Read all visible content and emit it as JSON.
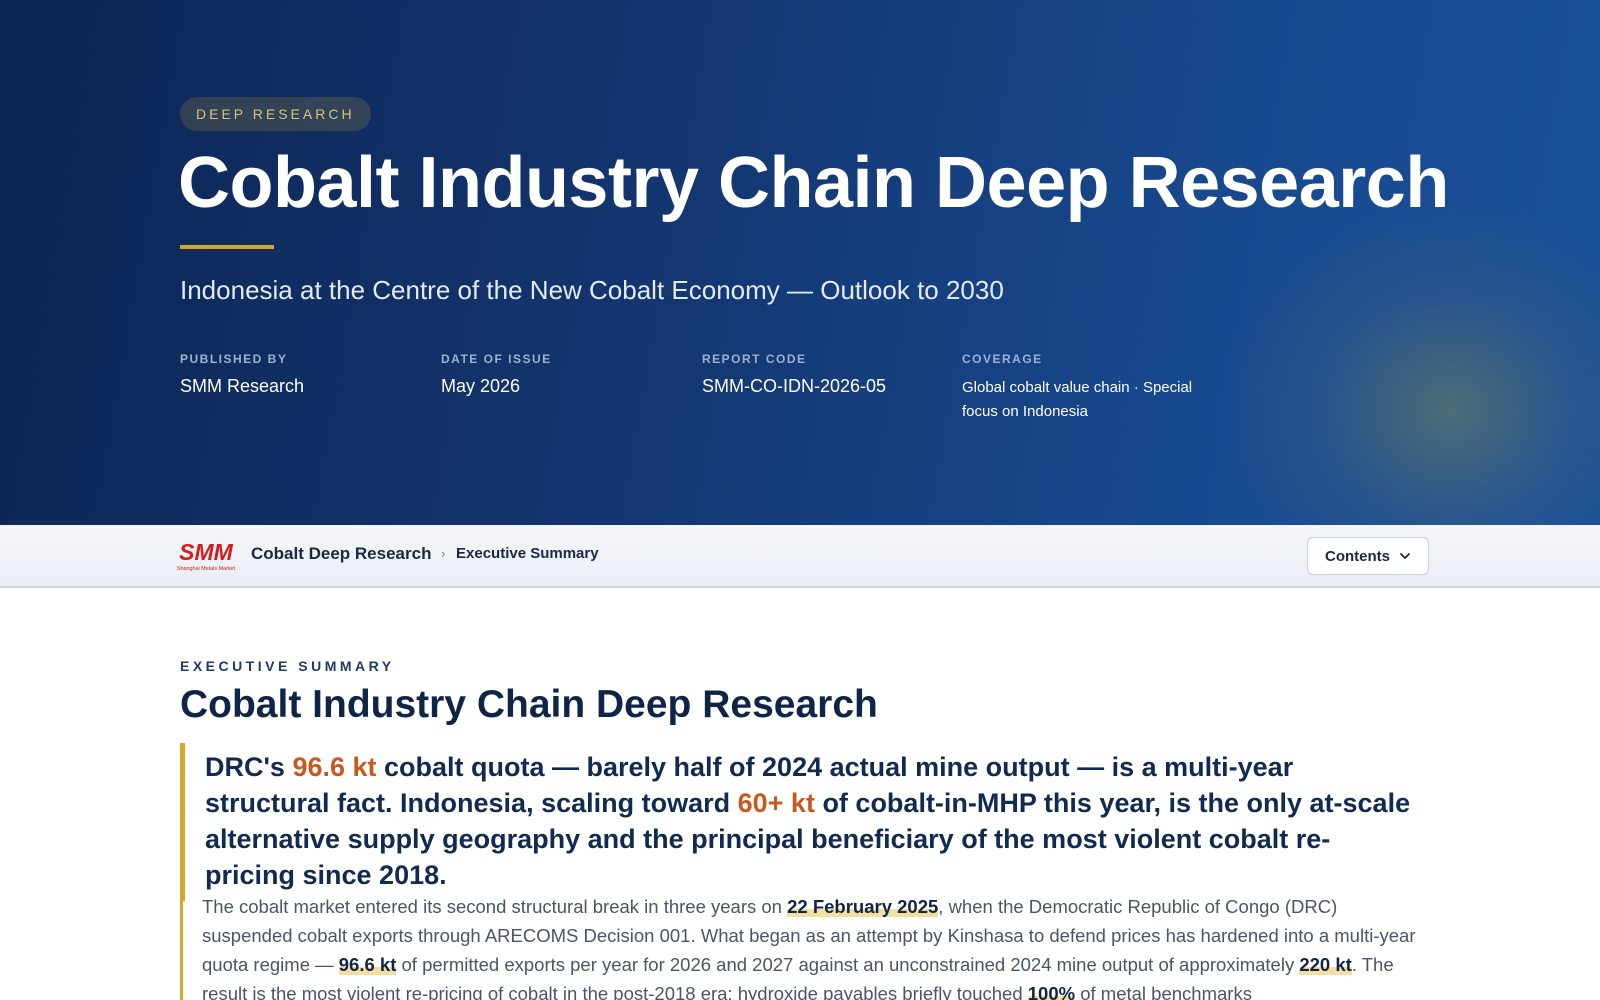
{
  "hero": {
    "badge": "DEEP RESEARCH",
    "title": "Cobalt Industry Chain Deep Research",
    "subtitle": "Indonesia at the Centre of the New Cobalt Economy — Outlook to 2030",
    "meta": [
      {
        "label": "PUBLISHED BY",
        "value": "SMM Research"
      },
      {
        "label": "DATE OF ISSUE",
        "value": "May 2026"
      },
      {
        "label": "REPORT CODE",
        "value": "SMM-CO-IDN-2026-05"
      },
      {
        "label": "COVERAGE",
        "value": "Global cobalt value chain · Special focus on Indonesia"
      }
    ]
  },
  "nav": {
    "logo_text": "SMM",
    "logo_subtext": "Shanghai Metals Market",
    "title": "Cobalt Deep Research",
    "separator": "›",
    "current": "Executive Summary",
    "contents_label": "Contents",
    "chevron_icon": "chevron-down-icon"
  },
  "main": {
    "eyebrow": "EXECUTIVE SUMMARY",
    "title": "Cobalt Industry Chain Deep Research",
    "lead": {
      "p1": "DRC's ",
      "h1": "96.6 kt",
      "p2": " cobalt quota — barely half of 2024 actual mine output — is a multi-year structural fact. Indonesia, scaling toward ",
      "h2": "60+ kt",
      "p3": " of cobalt-in-MHP this year, is the only at-scale alternative supply geography and the principal beneficiary of the most violent cobalt re-pricing since 2018."
    },
    "body": {
      "t1": "The cobalt market entered its second structural break in three years on ",
      "k1": "22 February 2025",
      "t2": ", when the Democratic Republic of Congo (DRC) suspended cobalt exports through ARECOMS Decision 001. What began as an attempt by Kinshasa to defend prices has hardened into a multi-year quota regime — ",
      "k2": "96.6 kt",
      "t3": " of permitted exports per year for 2026 and 2027 against an unconstrained 2024 mine output of approximately ",
      "k3": "220 kt",
      "t4": ". The result is the most violent re-pricing of cobalt in the post-2018 era: hydroxide payables briefly touched ",
      "k4": "100%",
      "t5": " of metal benchmarks"
    },
    "colors": {
      "accent_gold": "#d4a72c",
      "highlight_orange": "#c65a1e",
      "navy": "#0f2547"
    }
  }
}
